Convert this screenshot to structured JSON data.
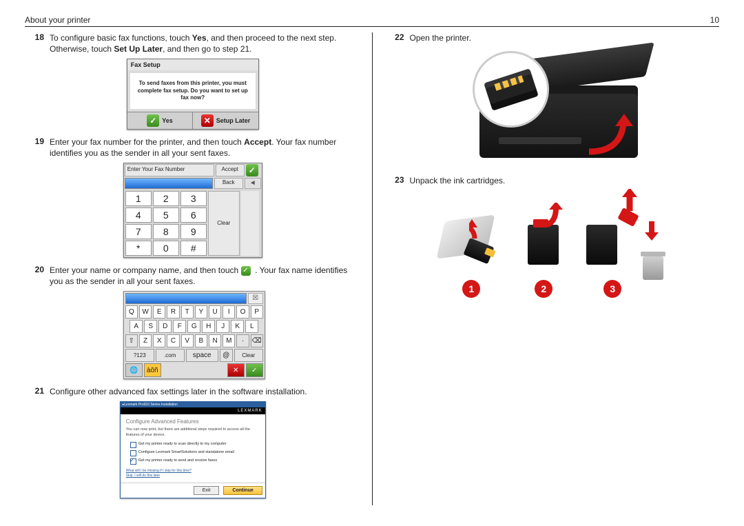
{
  "header": {
    "title": "About your printer",
    "page_number": "10"
  },
  "step18": {
    "pre": "To configure basic fax functions, touch ",
    "yes": "Yes",
    "mid1": ", and then proceed to the next step. Otherwise, touch ",
    "set": "Set Up Later",
    "post": ", and then go to step 21."
  },
  "fax_setup": {
    "title": "Fax Setup",
    "body": "To send faxes from this printer, you must complete fax setup. Do you want to set up fax now?",
    "yes": "Yes",
    "later": "Setup Later"
  },
  "step19": {
    "pre": "Enter your fax number for the printer, and then touch ",
    "accept": "Accept",
    "post": ". Your fax number identifies you as the sender in all your sent faxes."
  },
  "numpad": {
    "label": "Enter Your Fax Number",
    "accept": "Accept",
    "back": "Back",
    "clear": "Clear",
    "keys": [
      "1",
      "2",
      "3",
      "4",
      "5",
      "6",
      "7",
      "8",
      "9",
      "*",
      "0",
      "#"
    ]
  },
  "step20": {
    "pre": "Enter your name or company name, and then touch ",
    "post": ". Your fax name identifies you as the sender in all your sent faxes."
  },
  "keyboard": {
    "row1": [
      "Q",
      "W",
      "E",
      "R",
      "T",
      "Y",
      "U",
      "I",
      "O",
      "P"
    ],
    "row2": [
      "A",
      "S",
      "D",
      "F",
      "G",
      "H",
      "J",
      "K",
      "L"
    ],
    "row3_shift": "⇧",
    "row3": [
      "Z",
      "X",
      "C",
      "V",
      "B",
      "N",
      "M"
    ],
    "dot": "·",
    "bksp": "⌫",
    "num": "?123",
    "com": ".com",
    "space": "space",
    "at": "@",
    "clear": "Clear",
    "accents": "àôñ"
  },
  "step21": "Configure other advanced fax settings later in the software installation.",
  "installer": {
    "start": "▸Lexmark Pro910 Series Installation",
    "brand": "LEXMARK",
    "heading": "Configure Advanced Features",
    "desc": "You can now print, but there are additional steps required to access all the features of your device.",
    "opt1": "Get my printer ready to scan directly to my computer",
    "opt2": "Configure Lexmark SmartSolutions and standalone email",
    "opt3": "Get my printer ready to send and receive faxes",
    "link1": "What will I be missing if I skip for this time?",
    "link2": "Skip. I will do this later",
    "exit": "Exit",
    "cont": "Continue"
  },
  "step22": "Open the printer.",
  "step23": "Unpack the ink cartridges.",
  "circles": [
    "1",
    "2",
    "3"
  ]
}
